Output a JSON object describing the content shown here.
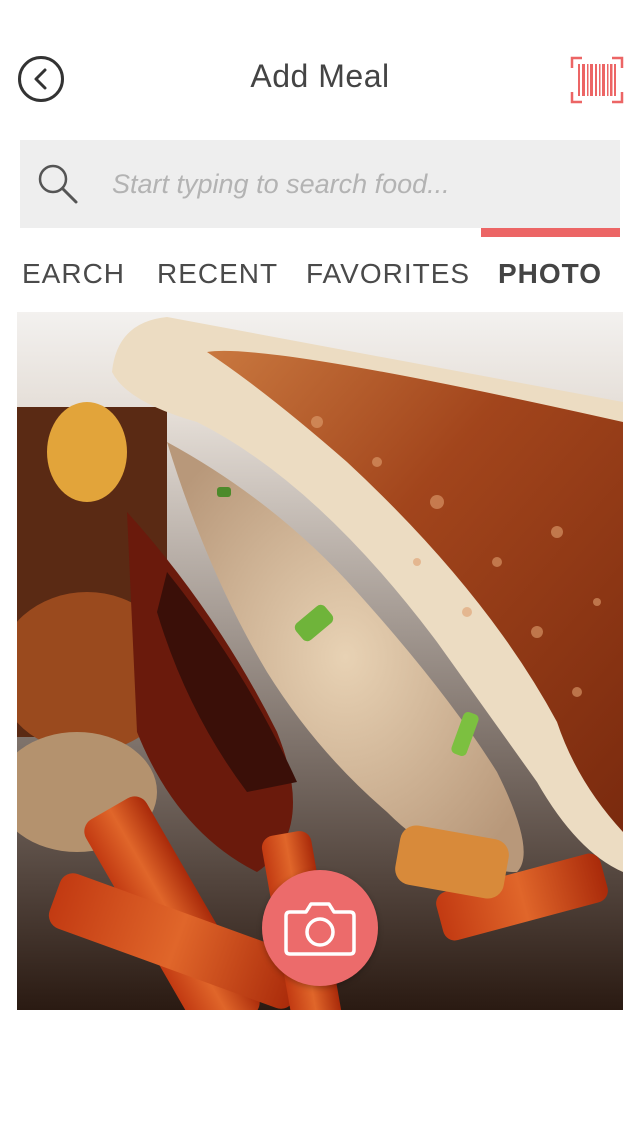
{
  "header": {
    "title": "Add Meal",
    "back_icon": "chevron-left-icon",
    "barcode_icon": "barcode-scan-icon"
  },
  "search": {
    "placeholder": "Start typing to search food...",
    "value": "",
    "icon": "search-icon"
  },
  "tabs": [
    {
      "label": "EARCH",
      "active": false
    },
    {
      "label": "RECENT",
      "active": false
    },
    {
      "label": "FAVORITES",
      "active": false
    },
    {
      "label": "PHOTO",
      "active": true
    }
  ],
  "photo": {
    "subject": "grilled tuna melt sandwich with sweet potato fries"
  },
  "camera": {
    "icon": "camera-icon"
  },
  "colors": {
    "accent": "#ec6565",
    "search_bg": "#eeeeee",
    "text": "#444444"
  }
}
